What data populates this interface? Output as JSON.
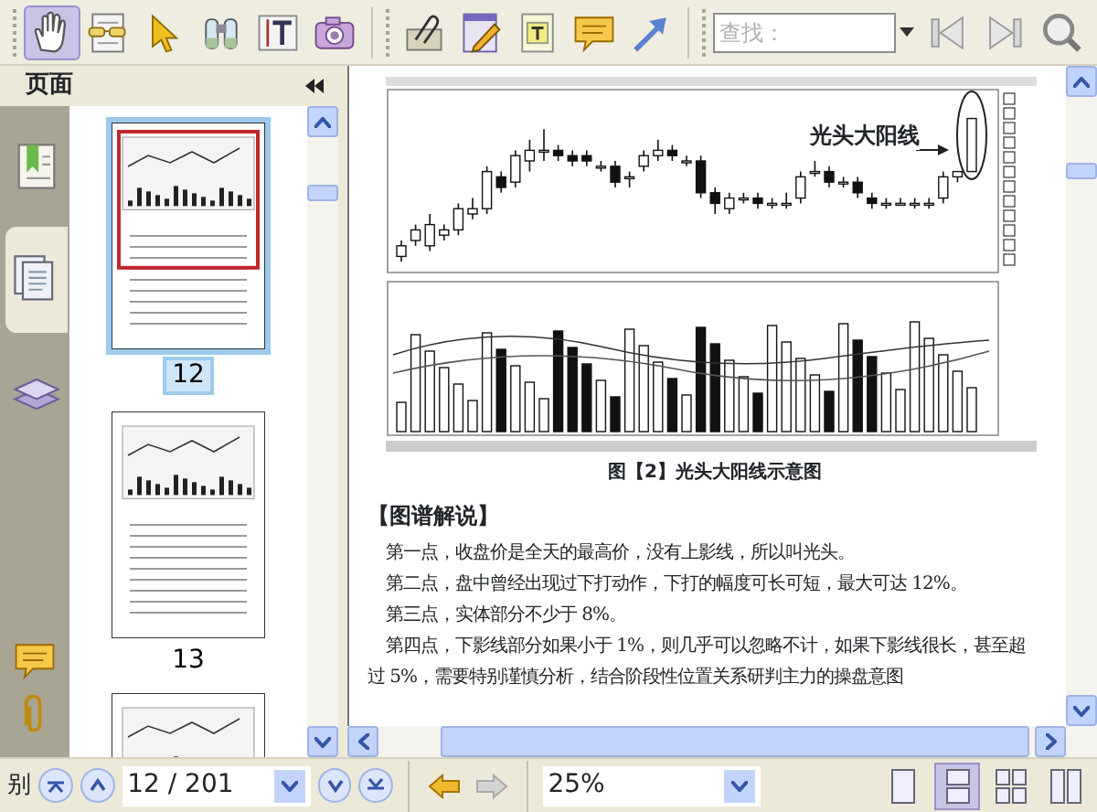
{
  "toolbar": {
    "tools": [
      {
        "kind": "hand",
        "selected": true
      },
      {
        "kind": "reader",
        "selected": false
      },
      {
        "kind": "pointer",
        "selected": false
      },
      {
        "kind": "binoculars",
        "selected": false
      },
      {
        "kind": "text-select",
        "selected": false
      },
      {
        "kind": "camera",
        "selected": false
      },
      {
        "kind": "attach",
        "selected": false
      },
      {
        "kind": "note",
        "selected": false
      },
      {
        "kind": "textbox",
        "selected": false
      },
      {
        "kind": "comment",
        "selected": false
      },
      {
        "kind": "arrow",
        "selected": false
      }
    ],
    "search": {
      "placeholder": "查找："
    },
    "search_buttons": [
      {
        "kind": "previous"
      },
      {
        "kind": "next"
      },
      {
        "kind": "search-zoom"
      }
    ]
  },
  "panel": {
    "title": "页面",
    "tabs": [
      {
        "kind": "bookmarks",
        "selected": false
      },
      {
        "kind": "pages",
        "selected": true
      },
      {
        "kind": "layers",
        "selected": false
      }
    ],
    "lower_tabs": [
      {
        "kind": "comment"
      },
      {
        "kind": "attachment"
      }
    ],
    "thumbnails": [
      {
        "label": "12",
        "selected": true
      },
      {
        "label": "13",
        "selected": false
      },
      {
        "selected": false
      }
    ]
  },
  "document": {
    "figure_label": "光头大阳线",
    "caption": "图【2】光头大阳线示意图",
    "heading": "【图谱解说】",
    "paragraphs": [
      {
        "text": "第一点，收盘价是全天的最高价，没有上影线，所以叫光头。",
        "indent": true
      },
      {
        "text": "第二点，盘中曾经出现过下打动作，下打的幅度可长可短，最大可达 12%。",
        "indent": true
      },
      {
        "text": "第三点，实体部分不少于 8%。",
        "indent": true
      },
      {
        "text": "第四点，下影线部分如果小于 1%，则几乎可以忽略不计，如果下影线很长，甚至超",
        "indent": true
      },
      {
        "text": "过 5%，需要特别谨慎分析，结合阶段性位置关系研判主力的操盘意图",
        "indent": false
      }
    ]
  },
  "status_bar": {
    "cut_text": "别",
    "page": "12 / 201",
    "zoom": "25%",
    "back_disabled": false,
    "forward_disabled": true,
    "view_modes": [
      {
        "kind": "single",
        "selected": false
      },
      {
        "kind": "continuous",
        "selected": true
      },
      {
        "kind": "facing",
        "selected": false
      },
      {
        "kind": "continuous-facing",
        "selected": false
      }
    ]
  }
}
